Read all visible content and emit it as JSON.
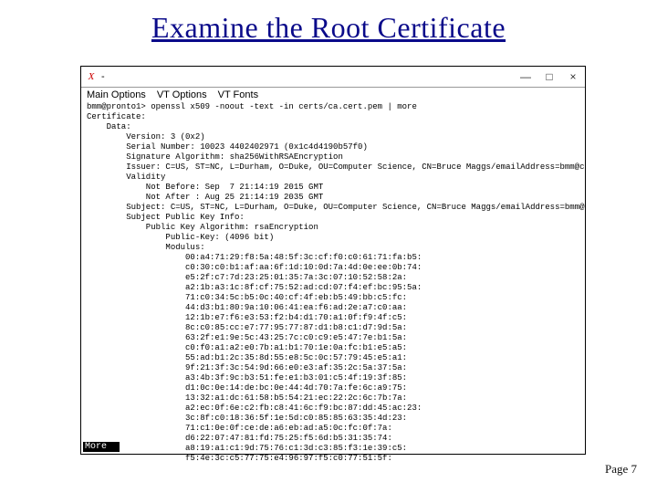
{
  "slide": {
    "title": "Examine the Root Certificate",
    "page_label": "Page 7"
  },
  "terminal": {
    "icon_glyph": "X",
    "title_text": "-",
    "window_controls": {
      "minimize": "—",
      "maximize": "□",
      "close": "×"
    },
    "menu": {
      "main": "Main Options",
      "vt_options": "VT Options",
      "vt_fonts": "VT Fonts"
    },
    "more_label": "More",
    "output_lines": [
      "bmm@pronto1> openssl x509 -noout -text -in certs/ca.cert.pem | more",
      "Certificate:",
      "    Data:",
      "        Version: 3 (0x2)",
      "        Serial Number: 10023 4402402971 (0x1c4d4190b57f0)",
      "        Signature Algorithm: sha256WithRSAEncryption",
      "        Issuer: C=US, ST=NC, L=Durham, O=Duke, OU=Computer Science, CN=Bruce Maggs/emailAddress=bmm@cs.duke.edu",
      "        Validity",
      "            Not Before: Sep  7 21:14:19 2015 GMT",
      "            Not After : Aug 25 21:14:19 2035 GMT",
      "        Subject: C=US, ST=NC, L=Durham, O=Duke, OU=Computer Science, CN=Bruce Maggs/emailAddress=bmm@cs.duke.edu",
      "        Subject Public Key Info:",
      "            Public Key Algorithm: rsaEncryption",
      "                Public-Key: (4096 bit)",
      "                Modulus:",
      "                    00:a4:71:29:f8:5a:48:5f:3c:cf:f0:c0:61:71:fa:b5:",
      "                    c0:30:c0:b1:af:aa:6f:1d:10:0d:7a:4d:0e:ee:0b:74:",
      "                    e5:2f:c7:7d:23:25:01:35:7a:3c:07:10:52:58:2a:",
      "                    a2:1b:a3:1c:8f:cf:75:52:ad:cd:07:f4:ef:bc:95:5a:",
      "                    71:c0:34:5c:b5:0c:40:cf:4f:eb:b5:49:bb:c5:fc:",
      "                    44:d3:b1:80:9a:10:06:41:ea:f6:ad:2e:a7:c0:aa:",
      "                    12:1b:e7:f6:e3:53:f2:b4:d1:70:a1:0f:f9:4f:c5:",
      "                    8c:c0:85:cc:e7:77:95:77:87:d1:b8:c1:d7:9d:5a:",
      "                    63:2f:e1:9e:5c:43:25:7c:c0:c9:e5:47:7e:b1:5a:",
      "                    c0:f0:a1:a2:e0:7b:a1:b1:70:1e:0a:fc:b1:e5:a5:",
      "                    55:ad:b1:2c:35:8d:55:e8:5c:0c:57:79:45:e5:a1:",
      "                    9f:21:3f:3c:54:9d:66:e0:e3:af:35:2c:5a:37:5a:",
      "                    a3:4b:3f:9c:b3:51:fe:e1:b3:01:c5:4f:19:3f:85:",
      "                    d1:0c:0e:14:de:bc:0e:44:4d:70:7a:fe:6c:a9:75:",
      "                    13:32:a1:dc:61:58:b5:54:21:ec:22:2c:6c:7b:7a:",
      "                    a2:ec:0f:6e:c2:fb:c8:41:6c:f9:bc:87:dd:45:ac:23:",
      "                    3c:8f:c0:18:36:5f:1e:5d:c0:85:85:63:35:4d:23:",
      "                    71:c1:0e:0f:ce:de:a6:eb:ad:a5:0c:fc:0f:7a:",
      "                    d6:22:07:47:81:fd:75:25:f5:6d:b5:31:35:74:",
      "                    a8:19:a1:c1:9d:75:76:c1:3d:c3:85:f3:1e:39:c5:",
      "                    f5:4e:3c:c5:77:75:e4:96:97:f5:c0:77:51:5f:"
    ]
  }
}
